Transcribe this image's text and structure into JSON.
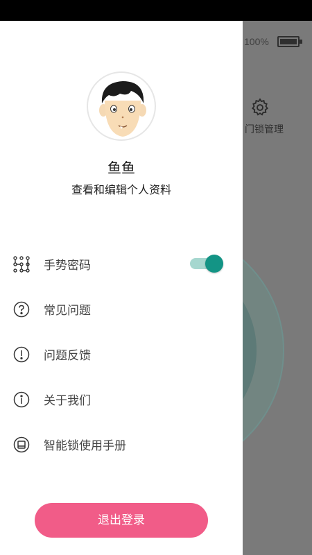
{
  "background": {
    "battery_text": "100%",
    "lock_manage_label": "门锁管理"
  },
  "drawer": {
    "username": "鱼鱼",
    "profile_link": "查看和编辑个人资料",
    "menu": [
      {
        "label": "手势密码",
        "icon": "gesture-pattern-icon",
        "toggle_on": true
      },
      {
        "label": "常见问题",
        "icon": "question-circle-icon"
      },
      {
        "label": "问题反馈",
        "icon": "exclamation-circle-icon"
      },
      {
        "label": "关于我们",
        "icon": "info-circle-icon"
      },
      {
        "label": "智能锁使用手册",
        "icon": "manual-icon"
      }
    ],
    "logout_label": "退出登录"
  },
  "colors": {
    "accent": "#139485",
    "logout_button": "#f15c88"
  }
}
